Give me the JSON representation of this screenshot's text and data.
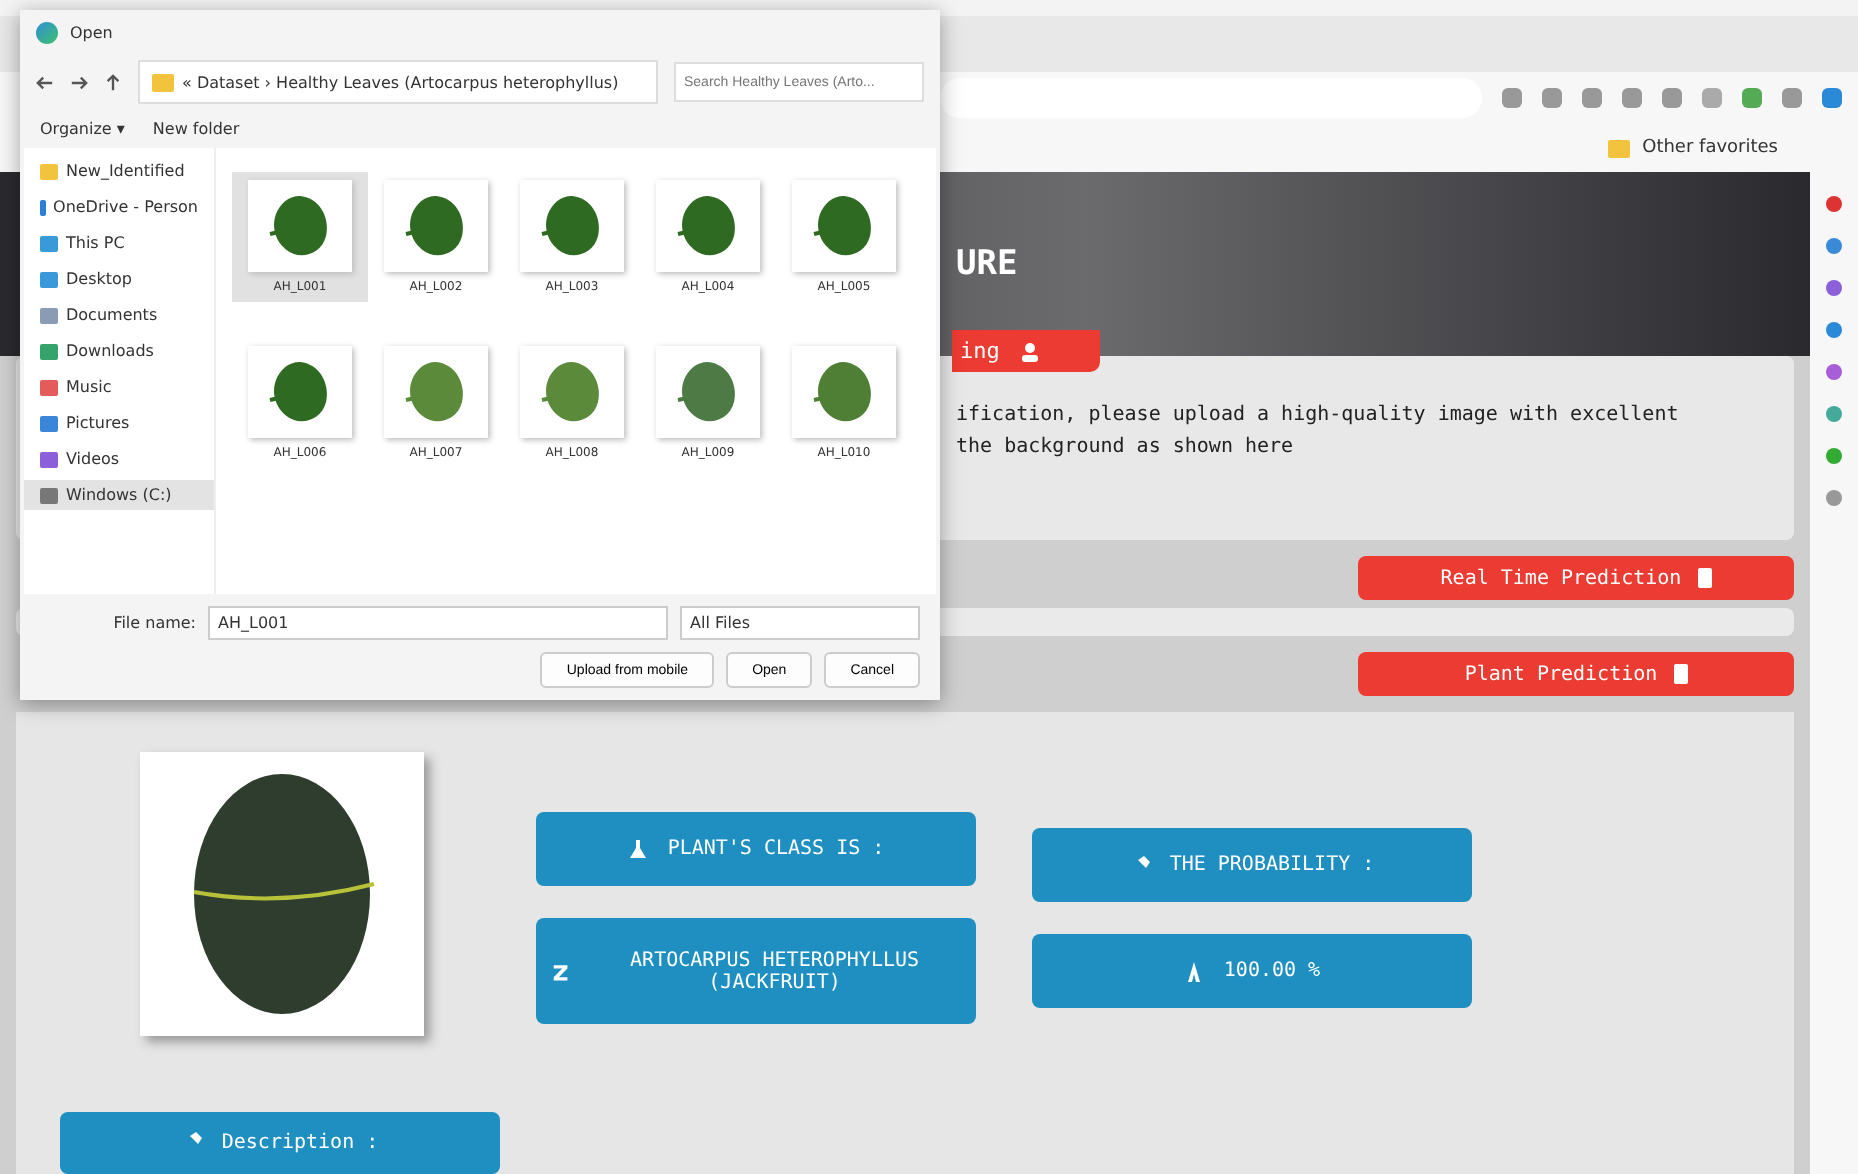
{
  "browser": {
    "favorites": "Other favorites"
  },
  "page": {
    "header_title": "URE",
    "tab_label": "ing",
    "intro_lines": [
      "ification, please upload a high-quality image with excellent",
      "the background as shown here"
    ],
    "realtime_button": "Real Time Prediction",
    "plant_button": "Plant Prediction",
    "results": {
      "class_label": "PLANT'S CLASS IS :",
      "class_value": "ARTOCARPUS HETEROPHYLLUS (JACKFRUIT)",
      "probability_label": "THE PROBABILITY :",
      "probability_value": "100.00 %",
      "description_label": "Description :"
    }
  },
  "dialog": {
    "title": "Open",
    "breadcrumb": "« Dataset › Healthy Leaves (Artocarpus heterophyllus)",
    "search": {
      "placeholder": "Search Healthy Leaves (Arto..."
    },
    "toolbar": [
      "Organize ▾",
      "New folder"
    ],
    "sidebar": [
      {
        "label": "New_Identified",
        "selected": false
      },
      {
        "label": "OneDrive - Person",
        "selected": false
      },
      {
        "label": "This PC",
        "selected": false
      },
      {
        "label": "Desktop",
        "selected": false
      },
      {
        "label": "Documents",
        "selected": false
      },
      {
        "label": "Downloads",
        "selected": false
      },
      {
        "label": "Music",
        "selected": false
      },
      {
        "label": "Pictures",
        "selected": false
      },
      {
        "label": "Videos",
        "selected": false
      },
      {
        "label": "Windows (C:)",
        "selected": true
      }
    ],
    "files": [
      {
        "name": "AH_L001",
        "selected": true
      },
      {
        "name": "AH_L002",
        "selected": false
      },
      {
        "name": "AH_L003",
        "selected": false
      },
      {
        "name": "AH_L004",
        "selected": false
      },
      {
        "name": "AH_L005",
        "selected": false
      },
      {
        "name": "AH_L006",
        "selected": false
      },
      {
        "name": "AH_L007",
        "selected": false
      },
      {
        "name": "AH_L008",
        "selected": false
      },
      {
        "name": "AH_L009",
        "selected": false
      },
      {
        "name": "AH_L010",
        "selected": false
      }
    ],
    "filename_label": "File name:",
    "filename": "AH_L001",
    "filetype": "All Files",
    "buttons": [
      "Upload from mobile",
      "Open",
      "Cancel"
    ]
  }
}
